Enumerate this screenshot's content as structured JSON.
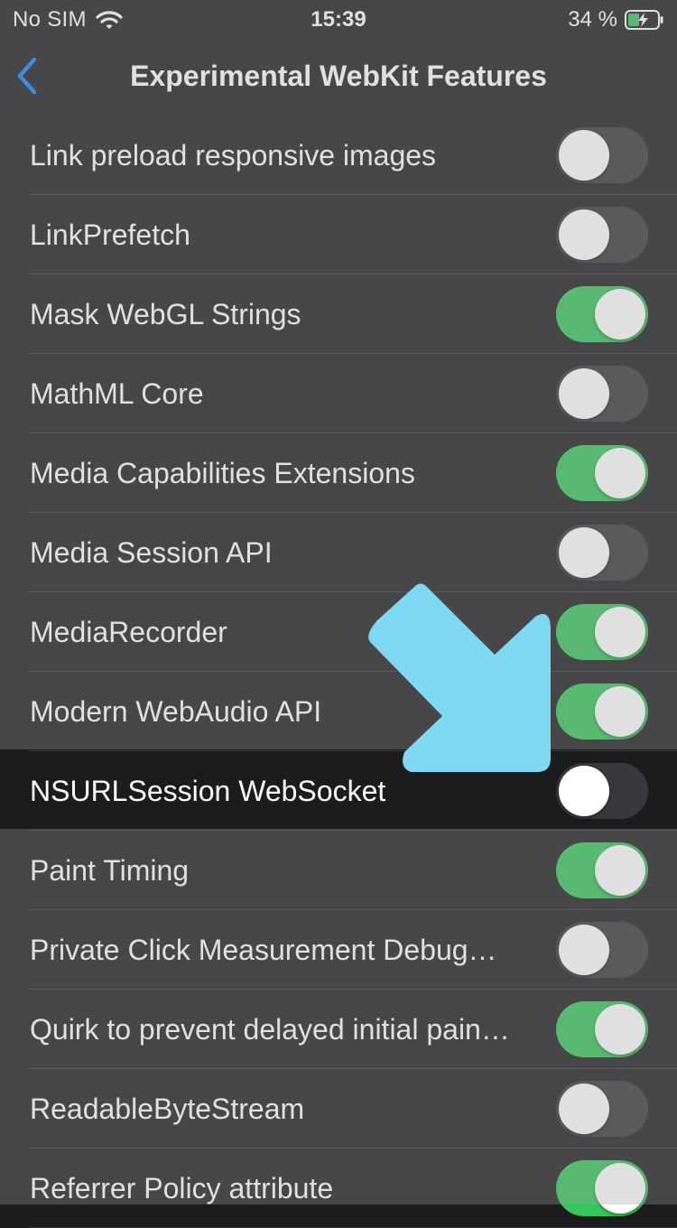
{
  "status_bar": {
    "carrier": "No SIM",
    "time": "15:39",
    "battery": "34 %"
  },
  "nav": {
    "title": "Experimental WebKit Features"
  },
  "features": [
    {
      "label": "Link preload responsive images",
      "enabled": false
    },
    {
      "label": "LinkPrefetch",
      "enabled": false
    },
    {
      "label": "Mask WebGL Strings",
      "enabled": true
    },
    {
      "label": "MathML Core",
      "enabled": false
    },
    {
      "label": "Media Capabilities Extensions",
      "enabled": true
    },
    {
      "label": "Media Session API",
      "enabled": false
    },
    {
      "label": "MediaRecorder",
      "enabled": true
    },
    {
      "label": "Modern WebAudio API",
      "enabled": true
    },
    {
      "label": "NSURLSession WebSocket",
      "enabled": false,
      "highlighted": true
    },
    {
      "label": "Paint Timing",
      "enabled": true
    },
    {
      "label": "Private Click Measurement Debug…",
      "enabled": false
    },
    {
      "label": "Quirk to prevent delayed initial pain…",
      "enabled": true
    },
    {
      "label": "ReadableByteStream",
      "enabled": false
    },
    {
      "label": "Referrer Policy attribute",
      "enabled": true
    }
  ],
  "colors": {
    "toggle_on": "#34c759",
    "toggle_off": "#39393d",
    "back_accent": "#0a84ff",
    "annotation_arrow": "#7fd8f2"
  },
  "icons": {
    "back": "chevron-left-icon",
    "wifi": "wifi-icon",
    "battery": "battery-charging-icon",
    "annotation": "arrow-down-right-icon"
  }
}
